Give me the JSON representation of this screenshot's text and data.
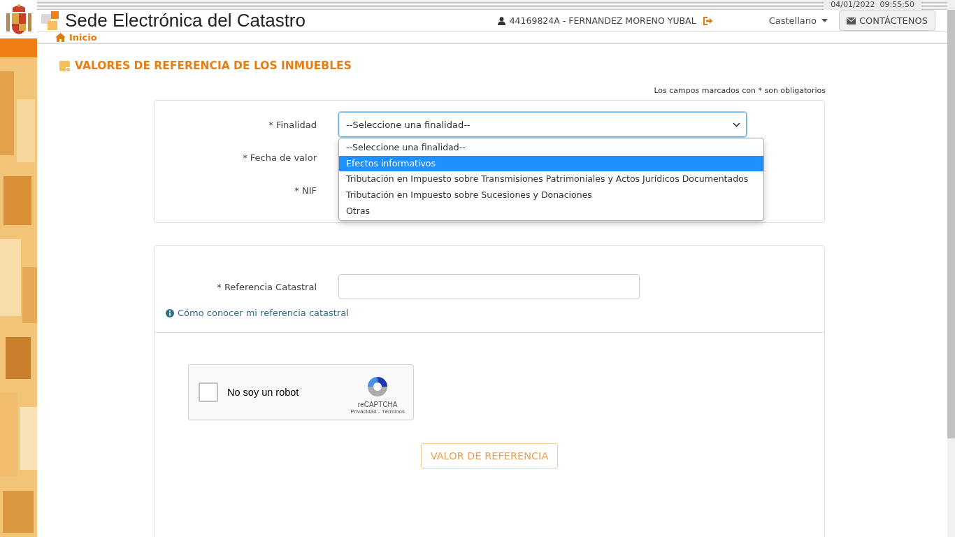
{
  "header": {
    "datetime": "04/01/2022  09:55:50",
    "site_title": "Sede Electrónica del Catastro",
    "user": "44169824A - FERNANDEZ MORENO YUBAL",
    "language": "Castellano",
    "contact_button": "CONTÁCTENOS"
  },
  "breadcrumb": "Inicio",
  "page_title": "VALORES DE REFERENCIA DE LOS INMUEBLES",
  "required_note": "Los campos marcados con * son obligatorios",
  "purpose_field": {
    "label": "* Finalidad",
    "value": "--Seleccione una finalidad--",
    "expanded": true,
    "options": [
      {
        "label": "--Seleccione una finalidad--",
        "highlighted": false
      },
      {
        "label": "Efectos informativos",
        "highlighted": true
      },
      {
        "label": "Tributación en Impuesto sobre Transmisiones Patrimoniales y Actos Jurídicos Documentados",
        "highlighted": false
      },
      {
        "label": "Tributación en Impuesto sobre Sucesiones y Donaciones",
        "highlighted": false
      },
      {
        "label": "Otras",
        "highlighted": false
      }
    ]
  },
  "other_labels": [
    "* Fecha de valor",
    "* NIF"
  ],
  "reference_field": {
    "label": "* Referencia Catastral"
  },
  "help_link": "Cómo conocer mi referencia catastral",
  "captcha": {
    "label": "No soy un robot",
    "checked": false,
    "brand": "reCAPTCHA",
    "terms": "Privacidad - Términos"
  },
  "submit_button": "VALOR DE REFERENCIA"
}
